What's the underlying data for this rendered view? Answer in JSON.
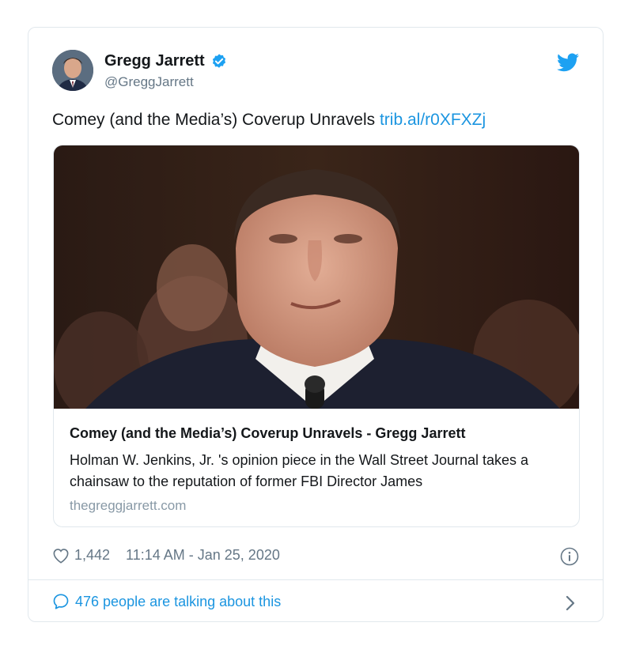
{
  "tweet": {
    "author_name": "Gregg Jarrett",
    "author_handle": "@GreggJarrett",
    "text_main": "Comey (and the Media’s) Coverup Unravels ",
    "text_link": "trib.al/r0XFXZj",
    "link_card": {
      "title": "Comey (and the Media’s) Coverup Unravels - Gregg Jarrett",
      "description": "Holman W. Jenkins, Jr. 's opinion piece in the Wall Street Journal takes a chainsaw to the reputation of former FBI Director James",
      "domain": "thegreggjarrett.com"
    },
    "likes": "1,442",
    "timestamp": "11:14 AM - Jan 25, 2020",
    "talking": "476 people are talking about this"
  },
  "icons": {
    "verified": "verified-badge-icon",
    "platform": "twitter-bird-icon",
    "like": "heart-icon",
    "info": "info-icon",
    "reply": "speech-bubble-icon",
    "more": "chevron-right-icon"
  },
  "colors": {
    "accent": "#1b95e0",
    "verified": "#1da1f2",
    "muted": "#657786",
    "border": "#e1e8ed"
  }
}
